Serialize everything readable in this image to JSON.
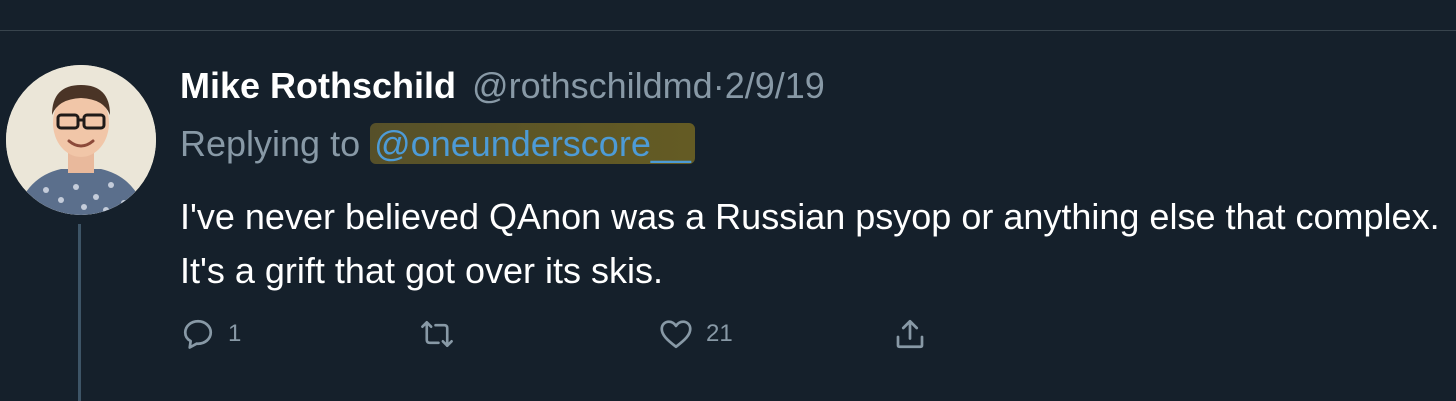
{
  "tweet": {
    "author_name": "Mike Rothschild",
    "handle": "@rothschildmd",
    "separator": "·",
    "date": "2/9/19",
    "replying_prefix": "Replying to",
    "replying_to": "@oneunderscore__",
    "text": "I've never believed QAnon was a Russian psyop or anything else that complex. It's a grift that got over its skis.",
    "actions": {
      "reply_icon": "reply-icon",
      "reply_count": "1",
      "retweet_icon": "retweet-icon",
      "like_icon": "heart-icon",
      "like_count": "21",
      "share_icon": "share-icon"
    }
  },
  "colors": {
    "background": "#15202b",
    "text_primary": "#ffffff",
    "text_secondary": "#8899a6",
    "link": "#4d9bd6",
    "divider": "#38444d"
  }
}
